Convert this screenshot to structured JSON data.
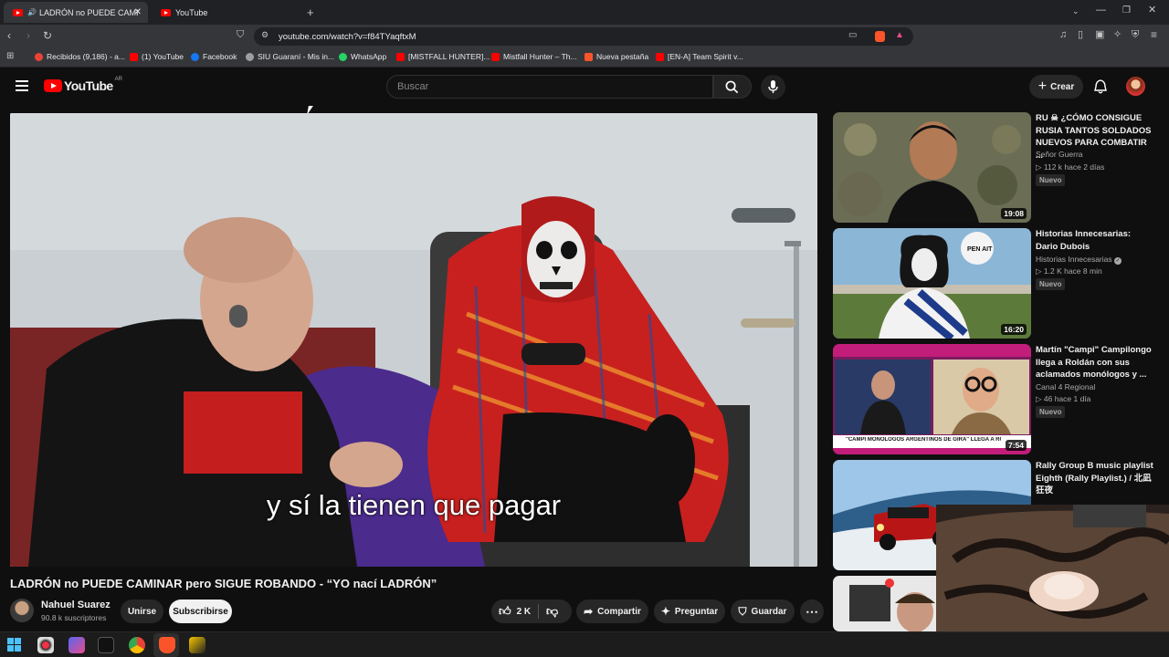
{
  "browser": {
    "tabs": [
      {
        "label": "LADRÓN no PUEDE CAMINAR pero SIGUE ROBANDO",
        "active": true
      },
      {
        "label": "YouTube",
        "active": false
      }
    ],
    "url": "youtube.com/watch?v=f84TYaqftxM",
    "bookmarks": [
      {
        "label": "Recibidos (9,186) - a...",
        "icon": "gmail-icon",
        "color": "#ea4335"
      },
      {
        "label": "(1) YouTube",
        "icon": "youtube-icon",
        "color": "#ff0000"
      },
      {
        "label": "Facebook",
        "icon": "facebook-icon",
        "color": "#1877f2"
      },
      {
        "label": "SIU Guaraní - Mis in...",
        "icon": "siu-icon",
        "color": "#9e9e9e"
      },
      {
        "label": "WhatsApp",
        "icon": "whatsapp-icon",
        "color": "#25d366"
      },
      {
        "label": "[MISTFALL HUNTER]...",
        "icon": "youtube-icon",
        "color": "#ff0000"
      },
      {
        "label": "Mistfall Hunter – Th...",
        "icon": "youtube-icon",
        "color": "#ff0000"
      },
      {
        "label": "Nueva pestaña",
        "icon": "brave-icon",
        "color": "#fb542b"
      },
      {
        "label": "[EN-A] Team Spirit v...",
        "icon": "youtube-icon",
        "color": "#ff0000"
      }
    ]
  },
  "header": {
    "logo": "YouTube",
    "region": "AR",
    "search_placeholder": "Buscar",
    "create_label": "Crear"
  },
  "video": {
    "caption": "y sí la tienen que pagar",
    "title": "LADRÓN no PUEDE CAMINAR pero SIGUE ROBANDO - “YO nací LADRÓN”",
    "channel": "Nahuel Suarez",
    "subscribers": "90.8 k suscriptores",
    "join_label": "Unirse",
    "subscribe_label": "Subscribirse",
    "likes": "2 K",
    "share_label": "Compartir",
    "ask_label": "Preguntar",
    "save_label": "Guardar"
  },
  "recommendations": [
    {
      "title": "RU ☠ ¿CÓMO CONSIGUE RUSIA TANTOS SOLDADOS NUEVOS PARA COMBATIR ...",
      "channel": "Señor Guerra",
      "meta": "▷ 112 k   hace 2 días",
      "badge": "Nuevo",
      "duration": "19:08"
    },
    {
      "title": "Historias Innecesarias: Dario Dubois",
      "channel": "Historias Innecesarias",
      "meta": "▷ 1.2 K   hace 8 min",
      "badge": "Nuevo",
      "duration": "16:20"
    },
    {
      "title": "Martín \"Campi\" Campilongo llega a Roldán con sus aclamados monólogos y ...",
      "channel": "Canal 4 Regional",
      "meta": "▷ 46   hace 1 día",
      "badge": "Nuevo",
      "duration": "7:54",
      "banner": "\"CAMPI MONÓLOGOS ARGENTINOS DE GIRA\" LLEGA A ROLDÁN"
    },
    {
      "title": "Rally Group B music playlist Eighth (Rally Playlist.) / 北凪狂夜",
      "channel": "",
      "meta": "",
      "badge": "",
      "duration": ""
    }
  ],
  "thumb_labels": {
    "ball": "PEN AIT"
  }
}
